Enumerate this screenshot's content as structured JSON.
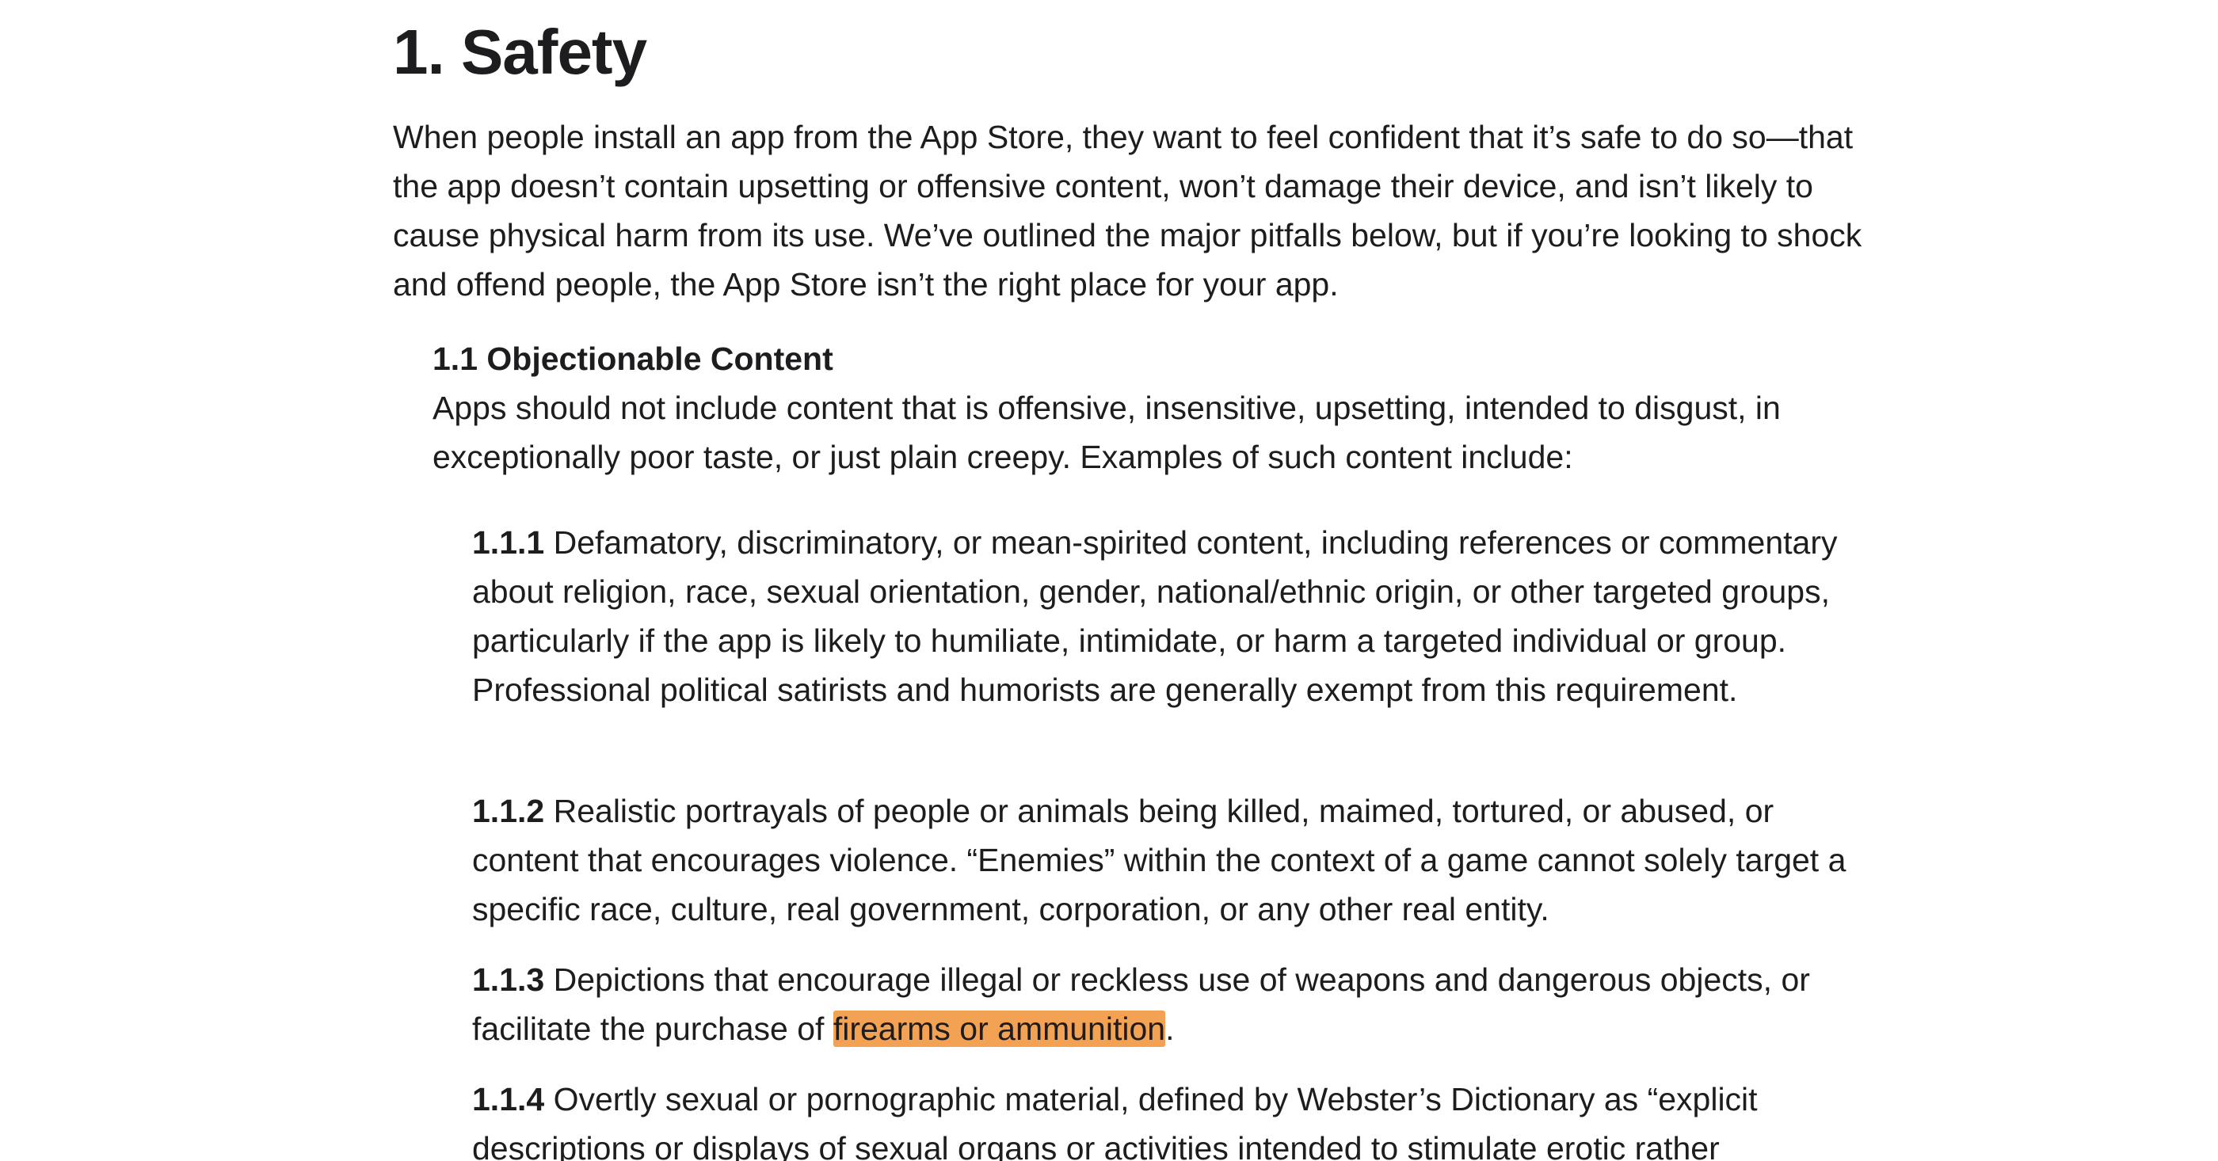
{
  "heading": "1. Safety",
  "intro": "When people install an app from the App Store, they want to feel confident that it’s safe to do so—that the app doesn’t contain upsetting or offensive content, won’t damage their device, and isn’t likely to cause physical harm from its use. We’ve outlined the major pitfalls below, but if you’re looking to shock and offend people, the App Store isn’t the right place for your app.",
  "section": {
    "title": "1.1 Objectionable Content",
    "body": "Apps should not include content that is offensive, insensitive, upsetting, intended to disgust, in exceptionally poor taste, or just plain creepy. Examples of such content include:"
  },
  "rules": [
    {
      "number": "1.1.1",
      "text": "Defamatory, discriminatory, or mean-spirited content, including references or commentary about religion, race, sexual orientation, gender, national/ethnic origin, or other targeted groups, particularly if the app is likely to humiliate, intimidate, or harm a targeted individual or group. Professional political satirists and humorists are generally exempt from this requirement."
    },
    {
      "number": "1.1.2",
      "text": "Realistic portrayals of people or animals being killed, maimed, tortured, or abused, or content that encourages violence. “Enemies” within the context of a game cannot solely target a specific race, culture, real government, corporation, or any other real entity."
    },
    {
      "number": "1.1.3",
      "text_before": "Depictions that encourage illegal or reckless use of weapons and dangerous objects, or facilitate the purchase of",
      "highlight": "firearms or ammunition",
      "text_after": "."
    },
    {
      "number": "1.1.4",
      "text": "Overtly sexual or pornographic material, defined by Webster’s Dictionary as “explicit descriptions or displays of sexual organs or activities intended to stimulate erotic rather"
    }
  ],
  "highlight_color": "#f3a153",
  "text_color": "#1d1d1f"
}
